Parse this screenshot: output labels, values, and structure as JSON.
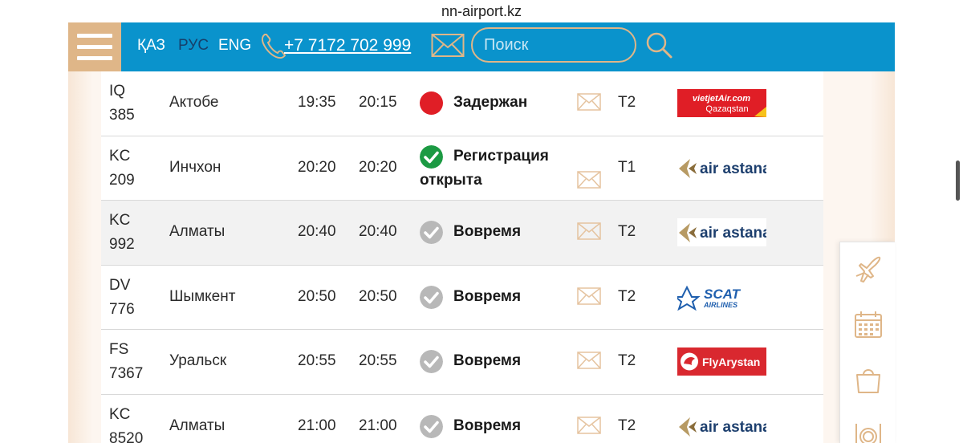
{
  "browser": {
    "url": "nn-airport.kz"
  },
  "header": {
    "languages": [
      {
        "label": "ҚАЗ",
        "active": false,
        "color": "#ffffff"
      },
      {
        "label": "РУС",
        "active": true,
        "color": "#16406b"
      },
      {
        "label": "ENG",
        "active": false,
        "color": "#ffffff"
      }
    ],
    "phone": "+7 7172 702 999",
    "search_placeholder": "Поиск"
  },
  "colors": {
    "header_bg": "#0a93cc",
    "accent": "#dfb688",
    "delayed": "#e01e26",
    "open": "#1c9a43",
    "ontime": "#b8b8b8"
  },
  "flights": [
    {
      "flight_line1": "IQ",
      "flight_line2": "385",
      "city": "Актобе",
      "time_scheduled": "19:35",
      "time_actual": "20:15",
      "status": "Задержан",
      "status_kind": "delayed",
      "terminal": "T2",
      "airline": "vietjet"
    },
    {
      "flight_line1": "KC",
      "flight_line2": "209",
      "city": "Инчхон",
      "time_scheduled": "20:20",
      "time_actual": "20:20",
      "status": "Регистрация открыта",
      "status_kind": "open",
      "terminal": "T1",
      "airline": "airastana"
    },
    {
      "flight_line1": "KC",
      "flight_line2": "992",
      "city": "Алматы",
      "time_scheduled": "20:40",
      "time_actual": "20:40",
      "status": "Вовремя",
      "status_kind": "ontime",
      "terminal": "T2",
      "airline": "airastana"
    },
    {
      "flight_line1": "DV",
      "flight_line2": "776",
      "city": "Шымкент",
      "time_scheduled": "20:50",
      "time_actual": "20:50",
      "status": "Вовремя",
      "status_kind": "ontime",
      "terminal": "T2",
      "airline": "scat"
    },
    {
      "flight_line1": "FS",
      "flight_line2": "7367",
      "city": "Уральск",
      "time_scheduled": "20:55",
      "time_actual": "20:55",
      "status": "Вовремя",
      "status_kind": "ontime",
      "terminal": "T2",
      "airline": "flyarystan"
    },
    {
      "flight_line1": "KC",
      "flight_line2": "8520",
      "city": "Алматы",
      "time_scheduled": "21:00",
      "time_actual": "21:00",
      "status": "Вовремя",
      "status_kind": "ontime",
      "terminal": "T2",
      "airline": "airastana"
    }
  ],
  "airline_logos": {
    "vietjet": {
      "line1": "vietjetAir.com",
      "line2": "Qazaqstan"
    },
    "airastana": {
      "text": "air astana"
    },
    "scat": {
      "line1": "SCAT",
      "line2": "AIRLINES"
    },
    "flyarystan": {
      "text": "FlyArystan"
    }
  },
  "side_panel": {
    "icons": [
      "plane-icon",
      "calendar-icon",
      "shopping-bag-icon",
      "dining-icon"
    ]
  }
}
